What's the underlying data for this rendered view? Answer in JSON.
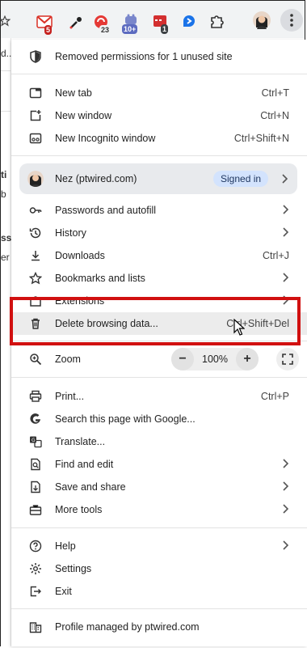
{
  "colors": {
    "highlight_box": "#d11010",
    "signed_in_bg": "#d3e3fd",
    "menu_bg": "#ffffff",
    "toolbar_bg": "#f1f3f4"
  },
  "toolbar": {
    "extensions": [
      {
        "icon": "gmail-icon",
        "badge": "5"
      },
      {
        "icon": "eyedropper-icon",
        "badge": ""
      },
      {
        "icon": "red-extension-icon",
        "badge": "23"
      },
      {
        "icon": "purple-extension-icon",
        "badge": "10+"
      },
      {
        "icon": "red-calendar-icon",
        "badge": "1"
      },
      {
        "icon": "blue-arrow-icon",
        "badge": ""
      },
      {
        "icon": "puzzle-icon",
        "badge": ""
      },
      {
        "icon": "profile-avatar",
        "badge": ""
      },
      {
        "icon": "kebab-menu-icon",
        "badge": ""
      }
    ]
  },
  "left_partial": [
    "d...",
    "ti",
    "b",
    "ssi",
    "er"
  ],
  "menu": {
    "removed_permissions": "Removed permissions for 1 unused site",
    "new_tab": {
      "label": "New tab",
      "shortcut": "Ctrl+T"
    },
    "new_window": {
      "label": "New window",
      "shortcut": "Ctrl+N"
    },
    "new_incognito": {
      "label": "New Incognito window",
      "shortcut": "Ctrl+Shift+N"
    },
    "profile": {
      "name": "Nez (ptwired.com)",
      "status": "Signed in"
    },
    "passwords": {
      "label": "Passwords and autofill"
    },
    "history": {
      "label": "History"
    },
    "downloads": {
      "label": "Downloads",
      "shortcut": "Ctrl+J"
    },
    "bookmarks": {
      "label": "Bookmarks and lists"
    },
    "extensions": {
      "label": "Extensions"
    },
    "delete_data": {
      "label": "Delete browsing data...",
      "shortcut": "Ctrl+Shift+Del"
    },
    "zoom": {
      "label": "Zoom",
      "minus": "−",
      "value": "100%",
      "plus": "+"
    },
    "print": {
      "label": "Print...",
      "shortcut": "Ctrl+P"
    },
    "search_page": {
      "label": "Search this page with Google..."
    },
    "translate": {
      "label": "Translate..."
    },
    "find_edit": {
      "label": "Find and edit"
    },
    "save_share": {
      "label": "Save and share"
    },
    "more_tools": {
      "label": "More tools"
    },
    "help": {
      "label": "Help"
    },
    "settings": {
      "label": "Settings"
    },
    "exit": {
      "label": "Exit"
    },
    "managed": {
      "label": "Profile managed by ptwired.com"
    }
  }
}
